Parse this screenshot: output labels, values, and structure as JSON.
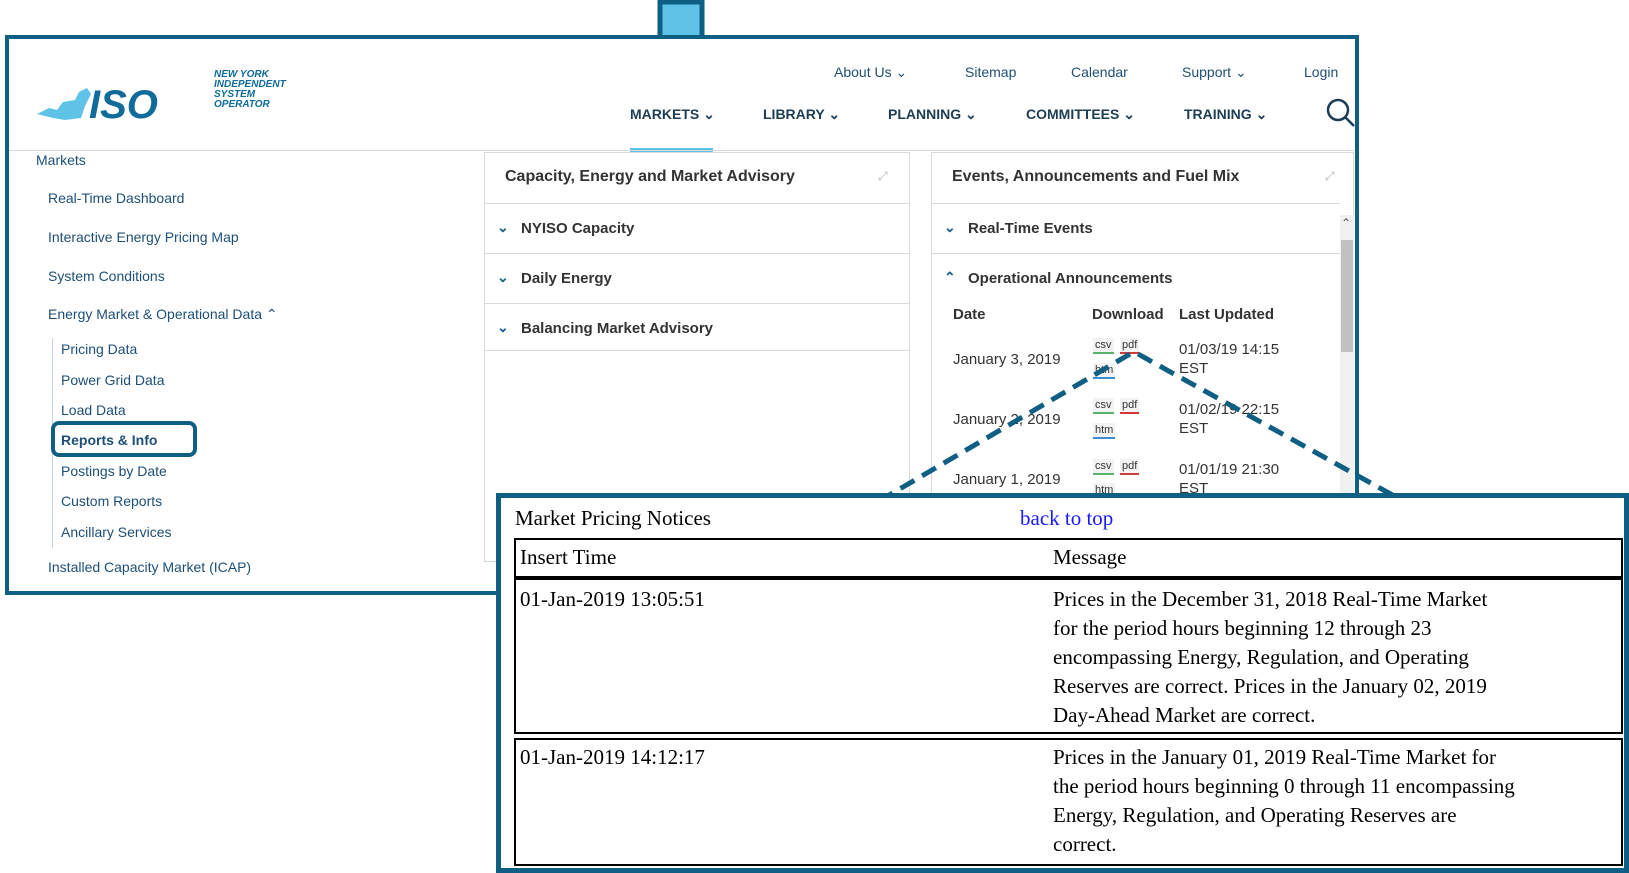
{
  "logo": {
    "mark": "ISO",
    "line1": "NEW YORK",
    "line2": "INDEPENDENT",
    "line3": "SYSTEM OPERATOR"
  },
  "top_nav": [
    "About Us",
    "Sitemap",
    "Calendar",
    "Support",
    "Login"
  ],
  "main_nav": [
    "MARKETS",
    "LIBRARY",
    "PLANNING",
    "COMMITTEES",
    "TRAINING"
  ],
  "sidebar": {
    "heading": "Markets",
    "items": [
      "Real-Time Dashboard",
      "Interactive Energy Pricing Map",
      "System Conditions",
      "Energy Market & Operational Data",
      "Installed Capacity Market (ICAP)"
    ],
    "sub_items": [
      "Pricing Data",
      "Power Grid Data",
      "Load Data",
      "Reports & Info",
      "Postings by Date",
      "Custom Reports",
      "Ancillary Services"
    ]
  },
  "panel1": {
    "title": "Capacity, Energy and Market Advisory",
    "rows": [
      "NYISO Capacity",
      "Daily Energy",
      "Balancing Market Advisory"
    ]
  },
  "panel2": {
    "title": "Events, Announcements and Fuel Mix",
    "rows": [
      "Real-Time Events",
      "Operational Announcements"
    ],
    "columns": {
      "date": "Date",
      "download": "Download",
      "updated": "Last Updated"
    },
    "entries": [
      {
        "date": "January 3, 2019",
        "updated": "01/03/19 14:15",
        "tz": "EST"
      },
      {
        "date": "January 2, 2019",
        "updated": "01/02/19 22:15",
        "tz": "EST"
      },
      {
        "date": "January 1, 2019",
        "updated": "01/01/19 21:30",
        "tz": "EST"
      }
    ],
    "chips": {
      "csv": "csv",
      "pdf": "pdf",
      "htm": "htm"
    }
  },
  "zoom": {
    "title": "Market Pricing Notices",
    "link": "back to top",
    "headers": [
      "Insert Time",
      "Message"
    ],
    "rows": [
      {
        "time": "01-Jan-2019 13:05:51",
        "lines": [
          "Prices in the December 31, 2018 Real-Time Market",
          "for the period hours beginning 12 through 23",
          "encompassing Energy, Regulation, and Operating",
          "Reserves are correct. Prices in the January 02, 2019",
          "Day-Ahead Market are correct."
        ]
      },
      {
        "time": "01-Jan-2019 14:12:17",
        "lines": [
          "Prices in the January 01, 2019 Real-Time Market for",
          "the period hours beginning 0 through 11 encompassing",
          "Energy, Regulation, and Operating Reserves are",
          "correct."
        ]
      }
    ]
  },
  "colors": {
    "frame": "#0f5f85",
    "arrow": "#5ec3e6",
    "link_blue": "#1a1aff"
  }
}
